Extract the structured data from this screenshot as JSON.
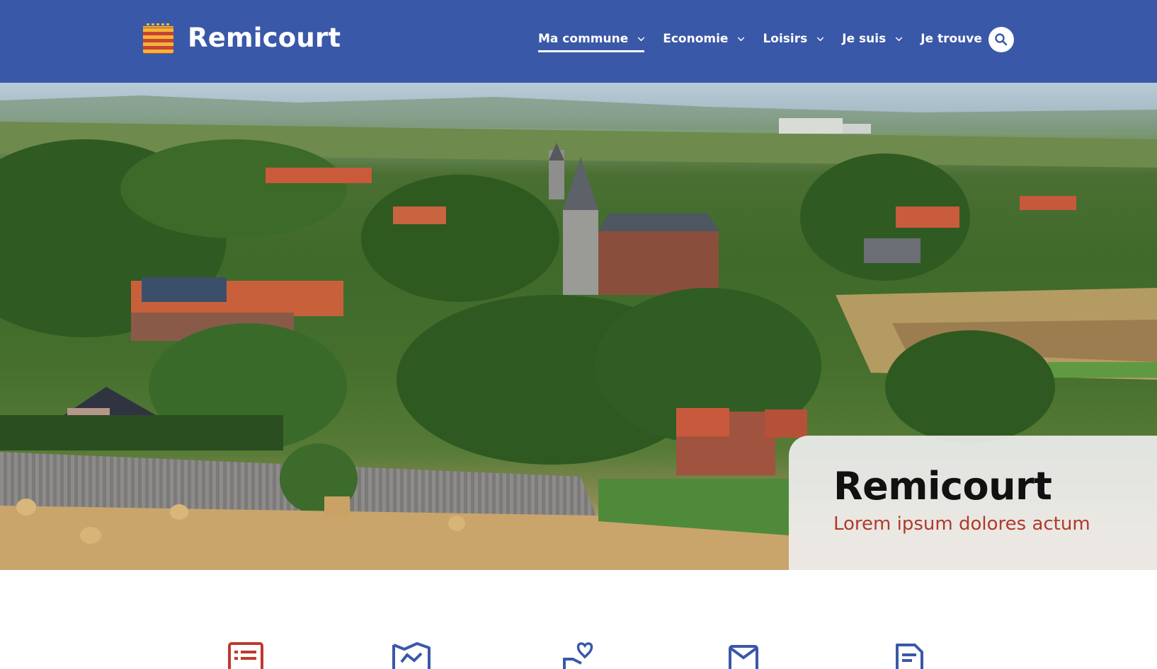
{
  "header": {
    "site_name": "Remicourt",
    "logo_icon": "remicourt-crest",
    "nav": [
      {
        "label": "Ma commune",
        "active": true
      },
      {
        "label": "Economie",
        "active": false
      },
      {
        "label": "Loisirs",
        "active": false
      },
      {
        "label": "Je suis",
        "active": false
      },
      {
        "label": "Je trouve",
        "active": false
      }
    ],
    "search_icon": "search-icon"
  },
  "hero": {
    "image": "village-landscape-photo",
    "title": "Remicourt",
    "subtitle": "Lorem ipsum dolores actum"
  },
  "quick_links": [
    {
      "icon": "news-list-icon",
      "color": "#c0392b"
    },
    {
      "icon": "map-icon",
      "color": "#3a58a8"
    },
    {
      "icon": "hand-heart-icon",
      "color": "#3a58a8"
    },
    {
      "icon": "mail-icon",
      "color": "#3a58a8"
    },
    {
      "icon": "document-icon",
      "color": "#3a58a8"
    }
  ],
  "colors": {
    "brand_blue": "#3a58a8",
    "accent_red": "#b13a2a",
    "crest_gold": "#f2b632"
  }
}
